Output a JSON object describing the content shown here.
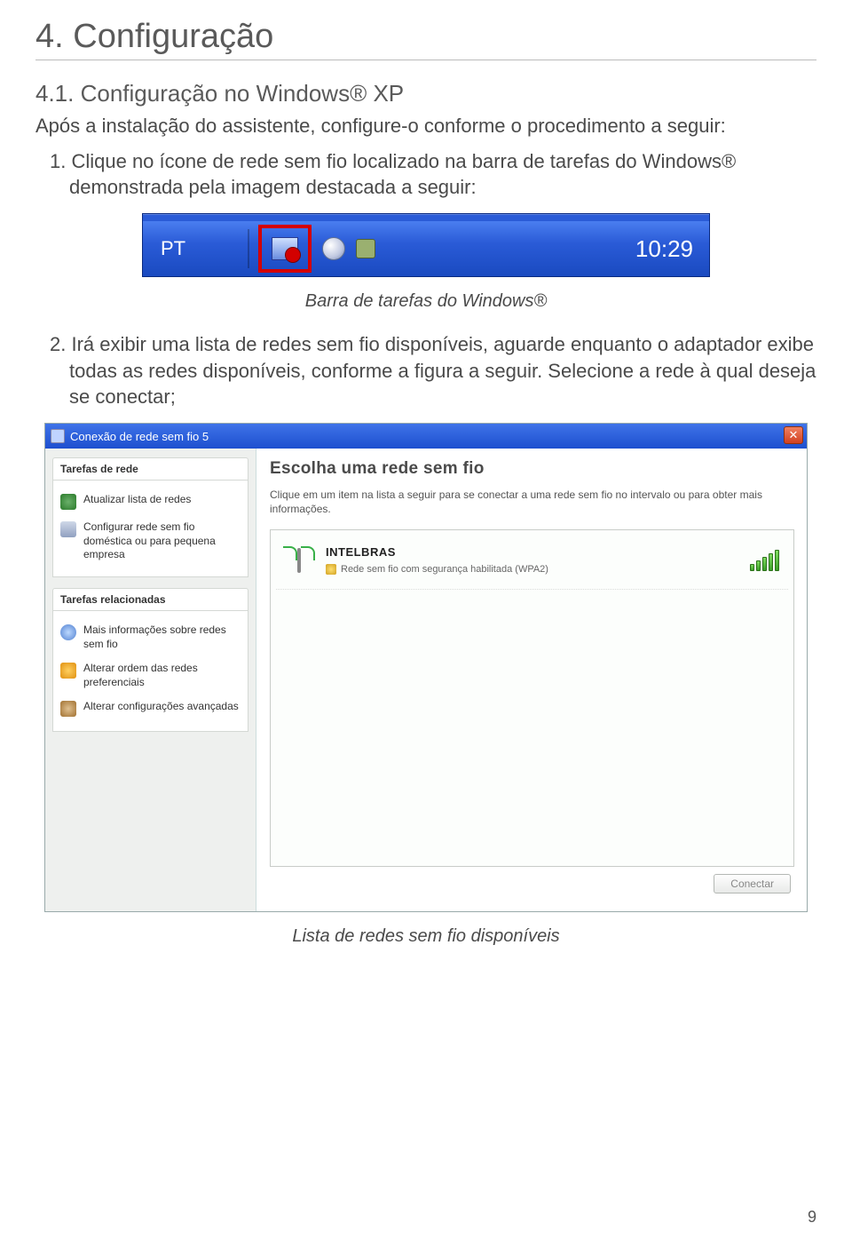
{
  "section": {
    "title": "4. Configuração",
    "sub_title": "4.1. Configuração no Windows® XP",
    "intro": "Após a instalação do assistente, configure-o conforme o procedimento a seguir:",
    "step1": "1. Clique no ícone de rede sem fio localizado na barra de tarefas do Windows® demonstrada pela imagem destacada a seguir:",
    "caption1": "Barra de tarefas do Windows®",
    "step2": "2. Irá exibir uma lista de redes sem fio disponíveis, aguarde enquanto o adaptador exibe todas as redes disponíveis, conforme a figura a seguir. Selecione a rede à qual deseja se conectar;",
    "caption2": "Lista de redes sem fio disponíveis"
  },
  "taskbar": {
    "lang": "PT",
    "clock": "10:29"
  },
  "wifi_dialog": {
    "title": "Conexão de rede sem fio 5",
    "side": {
      "head1": "Tarefas de rede",
      "items1": [
        "Atualizar lista de redes",
        "Configurar rede sem fio doméstica ou para pequena empresa"
      ],
      "head2": "Tarefas relacionadas",
      "items2": [
        "Mais informações sobre redes sem fio",
        "Alterar ordem das redes preferenciais",
        "Alterar configurações avançadas"
      ]
    },
    "main": {
      "heading": "Escolha uma rede sem fio",
      "desc": "Clique em um item na lista a seguir para se conectar a uma rede sem fio no intervalo ou para obter mais informações.",
      "network": {
        "name": "INTELBRAS",
        "sub": "Rede sem fio com segurança habilitada (WPA2)"
      },
      "connect": "Conectar"
    }
  },
  "page_num": "9"
}
